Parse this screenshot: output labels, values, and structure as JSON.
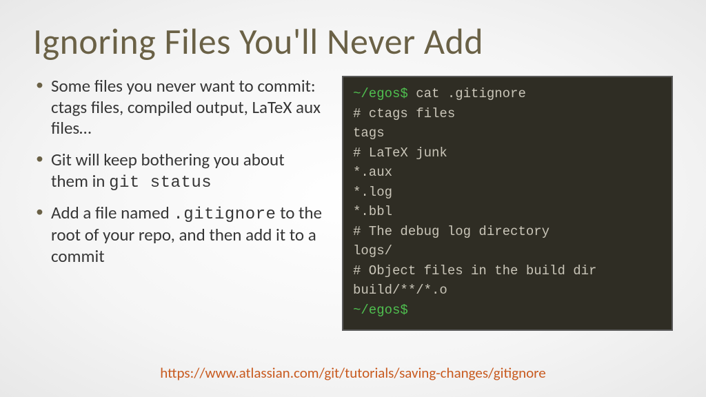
{
  "title": "Ignoring Files You'll Never Add",
  "bullets": [
    {
      "pre": "Some files you never want to commit: ctags files, compiled output, LaTeX aux files…",
      "mono": "",
      "post": ""
    },
    {
      "pre": "Git will keep bothering you about them in ",
      "mono": "git status",
      "post": ""
    },
    {
      "pre": "Add a file named ",
      "mono": ".gitignore",
      "post": " to the root of your repo, and then add it to a commit"
    }
  ],
  "terminal": {
    "prompt1": "~/egos$",
    "command": " cat .gitignore",
    "lines": [
      "# ctags files",
      "tags",
      "# LaTeX junk",
      "*.aux",
      "*.log",
      "*.bbl",
      "# The debug log directory",
      "logs/",
      "# Object files in the build dir",
      "build/**/*.o"
    ],
    "prompt2": "~/egos$"
  },
  "link": "https://www.atlassian.com/git/tutorials/saving-changes/gitignore"
}
